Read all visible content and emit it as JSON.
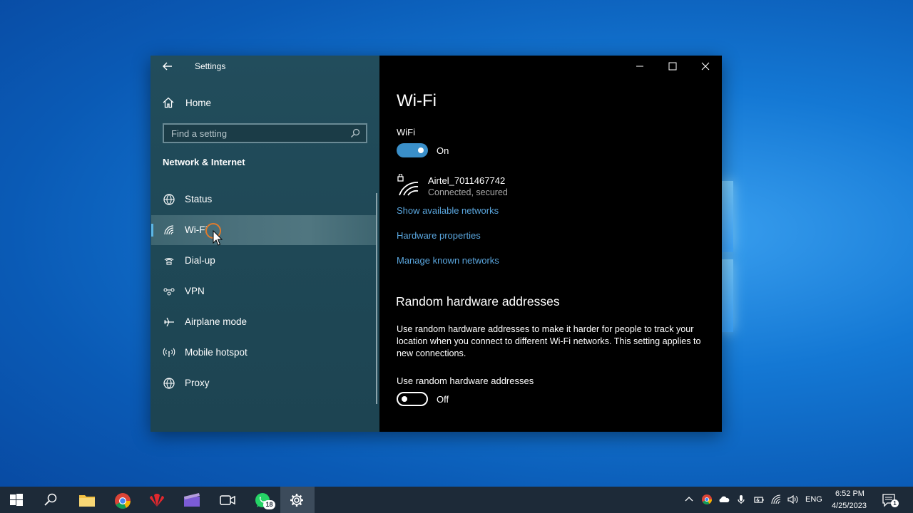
{
  "window": {
    "title": "Settings",
    "controls": [
      "minimize-icon",
      "maximize-icon",
      "close-icon"
    ]
  },
  "sidebar": {
    "home_label": "Home",
    "search_placeholder": "Find a setting",
    "section_header": "Network & Internet",
    "items": [
      {
        "label": "Status",
        "icon": "globe-status-icon",
        "active": false
      },
      {
        "label": "Wi-Fi",
        "icon": "wifi-icon",
        "active": true
      },
      {
        "label": "Dial-up",
        "icon": "dialup-icon",
        "active": false
      },
      {
        "label": "VPN",
        "icon": "vpn-icon",
        "active": false
      },
      {
        "label": "Airplane mode",
        "icon": "airplane-icon",
        "active": false
      },
      {
        "label": "Mobile hotspot",
        "icon": "hotspot-icon",
        "active": false
      },
      {
        "label": "Proxy",
        "icon": "globe-icon",
        "active": false
      }
    ]
  },
  "main": {
    "title": "Wi-Fi",
    "wifi_label": "WiFi",
    "wifi_toggle": {
      "state": "On"
    },
    "network": {
      "name": "Airtel_7011467742",
      "status": "Connected, secured"
    },
    "links": [
      "Show available networks",
      "Hardware properties",
      "Manage known networks"
    ],
    "random_heading": "Random hardware addresses",
    "random_desc": "Use random hardware addresses to make it harder for people to track your location when you connect to different Wi-Fi networks. This setting applies to new connections.",
    "random_toggle_label": "Use random hardware addresses",
    "random_toggle": {
      "state": "Off"
    }
  },
  "taskbar": {
    "apps": [
      "start-icon",
      "search-icon",
      "file-explorer-icon",
      "chrome-icon",
      "huawei-icon",
      "video-editor-icon",
      "camera-icon",
      "whatsapp-icon",
      "settings-icon"
    ],
    "whatsapp_badge": "18",
    "language": "ENG",
    "time": "6:52 PM",
    "date": "4/25/2023",
    "notification_count": "1"
  },
  "colors": {
    "sidebar_bg": "#1f4856",
    "main_bg": "#000000",
    "accent": "#3a8fc9",
    "link": "#5aa6de",
    "taskbar_bg": "#1d2a38"
  }
}
